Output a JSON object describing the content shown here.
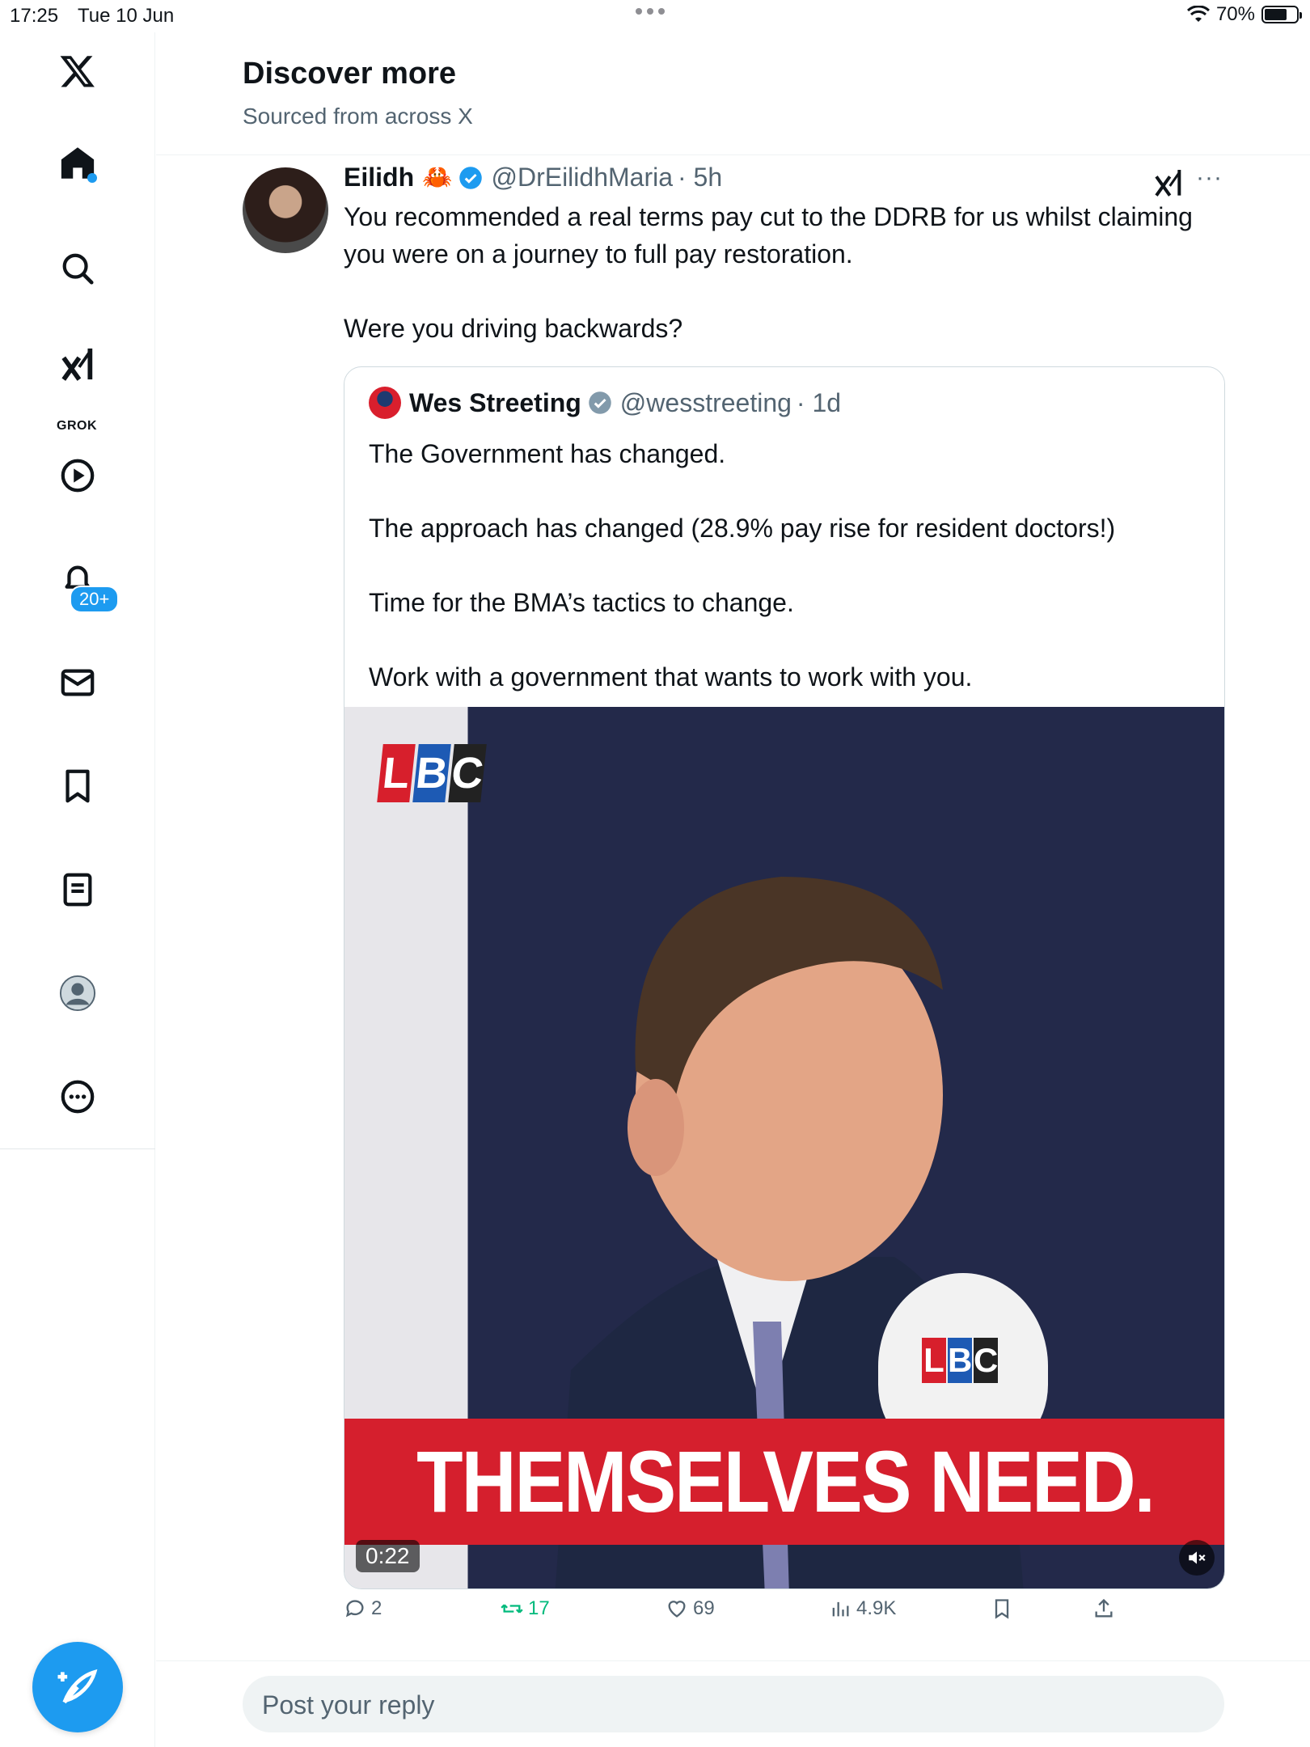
{
  "status_bar": {
    "time": "17:25",
    "date": "Tue 10 Jun",
    "battery": "70%",
    "battery_level": 0.7
  },
  "sidebar": {
    "notifications_badge": "20+",
    "grok_label": "GROK",
    "items": [
      "x-logo",
      "home",
      "search",
      "grok",
      "video",
      "notifications",
      "messages",
      "bookmarks",
      "lists",
      "profile",
      "more"
    ]
  },
  "header": {
    "title": "Discover more",
    "subtitle": "Sourced from across X"
  },
  "tweet": {
    "author_name": "Eilidh",
    "author_emoji": "🦀",
    "handle": "@DrEilidhMaria",
    "time": "· 5h",
    "more": "···",
    "text": [
      "You recommended a real terms pay cut to the DDRB for us whilst claiming you were on a journey to full pay restoration.",
      "Were you driving backwards?"
    ],
    "quote": {
      "author_name": "Wes Streeting",
      "handle": "@wesstreeting",
      "time": "· 1d",
      "text": [
        "The Government has changed.",
        "The approach has changed (28.9% pay rise for resident doctors!)",
        "Time for the BMA’s tactics to change.",
        "Work with a government that wants to work with you."
      ],
      "media": {
        "logo": [
          "L",
          "B",
          "C"
        ],
        "caption": "THEMSELVES NEED.",
        "duration": "0:22"
      }
    },
    "actions": {
      "replies": "2",
      "reposts": "17",
      "likes": "69",
      "views": "4.9K"
    }
  },
  "reply": {
    "placeholder": "Post your reply"
  },
  "colors": {
    "accent": "#1d9bf0",
    "repost_active": "#00ba7c",
    "caption_red": "#d51f2d"
  }
}
